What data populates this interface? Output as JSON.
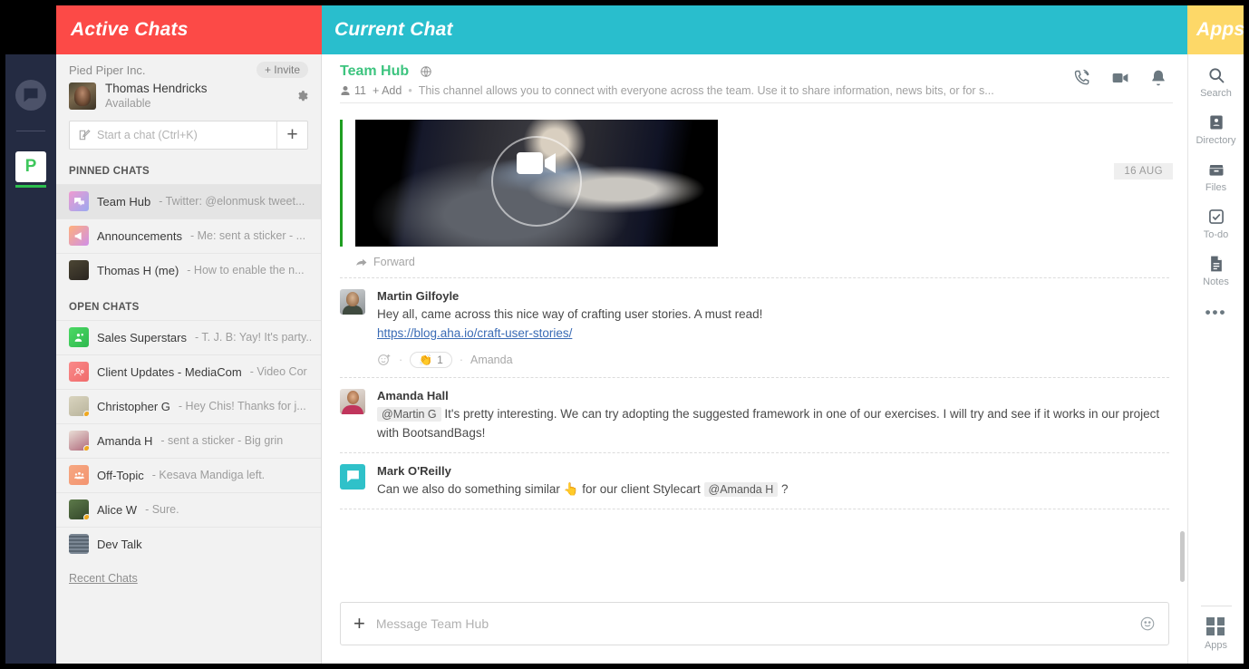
{
  "banners": {
    "active_chats": "Active Chats",
    "current_chat": "Current Chat",
    "apps": "Apps"
  },
  "colors": {
    "banner_red": "#fc4a47",
    "banner_teal": "#29becd",
    "banner_yellow": "#fdd868",
    "rail_dark": "#242b42",
    "channel_green": "#3dc47f",
    "team_green": "#2cbf4e",
    "link_blue": "#3a6bb5",
    "mark_avatar_teal": "#2fc1c9"
  },
  "rail": {
    "app_logo_icon": "chat-bubble-icon",
    "team_initial": "P"
  },
  "sidebar": {
    "org_name": "Pied Piper Inc.",
    "invite_label": "+ Invite",
    "user": {
      "name": "Thomas Hendricks",
      "status": "Available"
    },
    "settings_icon": "gear-icon",
    "search": {
      "placeholder": "Start a chat (Ctrl+K)",
      "value": "",
      "icon": "compose-icon",
      "add_label": "+"
    },
    "pinned_label": "PINNED CHATS",
    "open_label": "OPEN CHATS",
    "recent_link": "Recent Chats",
    "pinned": [
      {
        "name": "Team Hub",
        "preview": "- Twitter: @elonmusk tweet...",
        "avatar": "group-chat-icon",
        "color1": "#f09ad0",
        "color2": "#9aa8f0",
        "active": true,
        "presence": false
      },
      {
        "name": "Announcements",
        "preview": "- Me: sent a sticker - ...",
        "avatar": "megaphone-icon",
        "color1": "#ffb07c",
        "color2": "#cf8fe8",
        "active": false,
        "presence": false
      },
      {
        "name": "Thomas H (me)",
        "preview": "- How to enable the n...",
        "avatar": "photo-avatar",
        "color1": "#4c4634",
        "color2": "#2a2520",
        "active": false,
        "presence": false
      }
    ],
    "open": [
      {
        "name": "Sales Superstars",
        "preview": "- T. J. B: Yay! It's party...",
        "avatar": "team-icon",
        "color1": "#4cd964",
        "color2": "#2fb84f",
        "active": false,
        "presence": false
      },
      {
        "name": "Client Updates - MediaCom",
        "preview": "- Video Cor",
        "avatar": "client-icon",
        "color1": "#f98a8a",
        "color2": "#f06b6b",
        "active": false,
        "presence": false
      },
      {
        "name": "Christopher G",
        "preview": "- Hey Chis! Thanks for j...",
        "avatar": "photo-avatar",
        "color1": "#d9d4bf",
        "color2": "#b9b49c",
        "active": false,
        "presence": true
      },
      {
        "name": "Amanda H",
        "preview": "- sent a sticker - Big grin",
        "avatar": "photo-avatar",
        "color1": "#e9ded6",
        "color2": "#b06a7c",
        "active": false,
        "presence": true
      },
      {
        "name": "Off-Topic",
        "preview": "- Kesava Mandiga left.",
        "avatar": "people-icon",
        "color1": "#f6a882",
        "color2": "#f39470",
        "active": false,
        "presence": false
      },
      {
        "name": "Alice W",
        "preview": "- Sure.",
        "avatar": "photo-avatar",
        "color1": "#5d7a4a",
        "color2": "#33462a",
        "active": false,
        "presence": true
      },
      {
        "name": "Dev Talk",
        "preview": "",
        "avatar": "pattern-icon",
        "color1": "#7b8794",
        "color2": "#5a6672",
        "active": false,
        "presence": false
      }
    ]
  },
  "channel": {
    "title": "Team Hub",
    "title_icon": "globe-icon",
    "member_count": "11",
    "add_label": "+ Add",
    "separator": "•",
    "description": "This channel allows you to connect with everyone across the team. Use it to share information, news bits, or for s...",
    "actions": [
      {
        "name": "call-icon",
        "label": "Call"
      },
      {
        "name": "video-icon",
        "label": "Video"
      },
      {
        "name": "bell-icon",
        "label": "Notifications"
      }
    ],
    "date_chip": "16 AUG"
  },
  "messages": [
    {
      "type": "attachment",
      "attachment_kind": "video",
      "play_icon": "video-camera-icon",
      "forward_label": "Forward",
      "forward_icon": "forward-arrow-icon"
    },
    {
      "type": "text",
      "author": "Martin Gilfoyle",
      "avatar": "martin-avatar",
      "text": "Hey all, came across this nice way of crafting user stories. A must read!",
      "link": "https://blog.aha.io/craft-user-stories/",
      "reactions": {
        "add_icon": "add-reaction-icon",
        "emoji": "👏",
        "count": "1",
        "who": "Amanda",
        "dot": "·"
      }
    },
    {
      "type": "text",
      "author": "Amanda Hall",
      "avatar": "amanda-avatar",
      "mention": "@Martin G",
      "text": "It's pretty interesting. We can try adopting the suggested framework in one of our exercises. I will try and see if it works in our project with BootsandBags!"
    },
    {
      "type": "text",
      "author": "Mark O'Reilly",
      "avatar": "mark-avatar",
      "text_before": "Can we also do something similar",
      "emoji": "👆",
      "text_mid": "for our client Stylecart",
      "mention": "@Amanda H",
      "text_after": "?"
    }
  ],
  "composer": {
    "add_icon": "+",
    "placeholder": "Message Team Hub",
    "value": "",
    "emoji_icon": "smiley-icon"
  },
  "apps_panel": {
    "items": [
      {
        "label": "Search",
        "icon": "search-icon"
      },
      {
        "label": "Directory",
        "icon": "directory-icon"
      },
      {
        "label": "Files",
        "icon": "files-icon"
      },
      {
        "label": "To-do",
        "icon": "checkbox-icon"
      },
      {
        "label": "Notes",
        "icon": "notes-icon"
      }
    ],
    "more_icon": "ellipsis-icon",
    "bottom": {
      "label": "Apps",
      "icon": "grid-icon"
    }
  }
}
